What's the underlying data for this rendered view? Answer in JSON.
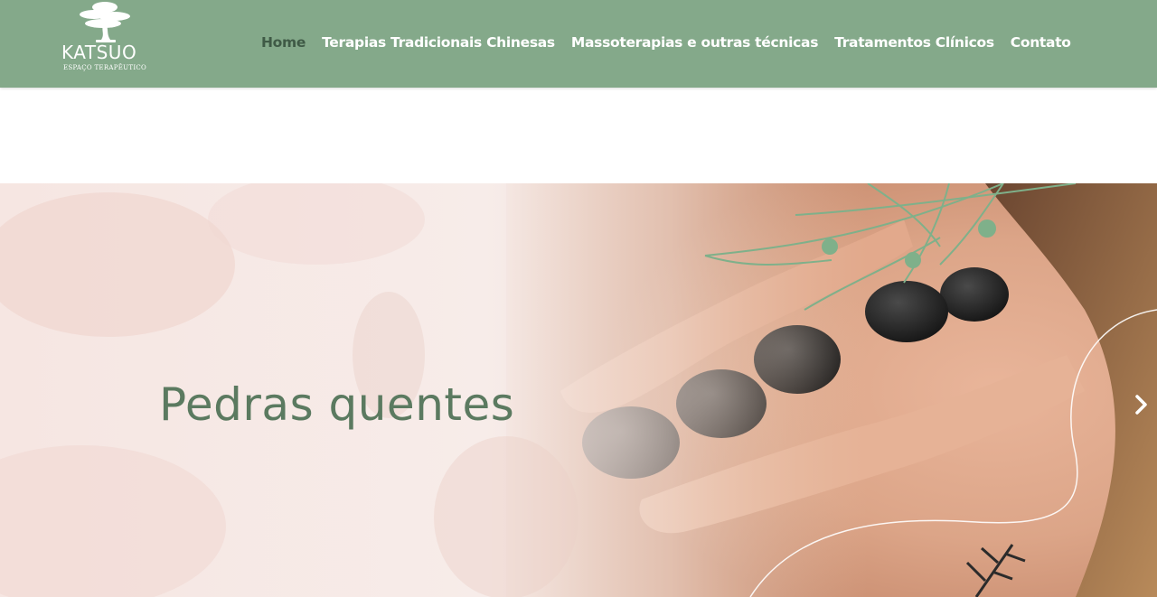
{
  "brand": {
    "name": "KATSUO",
    "tagline": "ESPAÇO TERAPÊUTICO"
  },
  "nav": {
    "items": [
      {
        "label": "Home",
        "active": true
      },
      {
        "label": "Terapias Tradicionais Chinesas",
        "active": false
      },
      {
        "label": "Massoterapias e outras técnicas",
        "active": false
      },
      {
        "label": "Tratamentos Clínicos",
        "active": false
      },
      {
        "label": "Contato",
        "active": false
      }
    ]
  },
  "hero": {
    "title": "Pedras quentes",
    "next_icon": "chevron-right-icon"
  },
  "colors": {
    "header_bg": "#84a98a",
    "active_nav": "#3f5a46",
    "title": "#5b7a60",
    "leaf": "#7fb08a"
  }
}
